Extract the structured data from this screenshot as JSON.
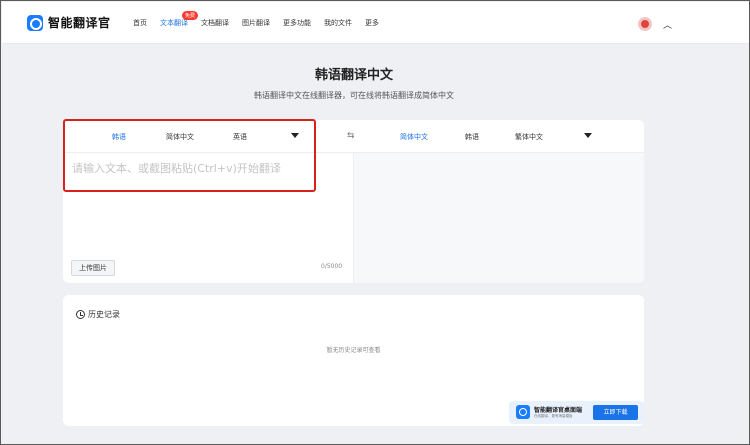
{
  "header": {
    "app_name": "智能翻译官",
    "nav": [
      {
        "label": "首页"
      },
      {
        "label": "文本翻译",
        "badge": "免费"
      },
      {
        "label": "文档翻译"
      },
      {
        "label": "图片翻译"
      },
      {
        "label": "更多功能"
      },
      {
        "label": "我的文件"
      },
      {
        "label": "更多"
      }
    ],
    "icons": {
      "logo": "app-logo",
      "avatar": "user-avatar",
      "collapse": "chevron-up-icon"
    }
  },
  "page": {
    "title": "韩语翻译中文",
    "subtitle": "韩语翻译中文在线翻译器，可在线将韩语翻译成简体中文"
  },
  "translator": {
    "source_langs": [
      "韩语",
      "简体中文",
      "英语"
    ],
    "source_selected": "韩语",
    "target_langs": [
      "简体中文",
      "韩语",
      "繁体中文"
    ],
    "target_selected": "简体中文",
    "placeholder": "请输入文本、或截图粘贴(Ctrl+v)开始翻译",
    "upload_label": "上传图片",
    "char_count": "0/5000",
    "swap_icon": "swap-arrows-icon",
    "accent": "#1a73e8",
    "highlight_color": "#d9211b"
  },
  "history": {
    "title": "历史记录",
    "empty_text": "暂无历史记录可查看"
  },
  "promo": {
    "title": "智能翻译官桌面端",
    "subtitle": "在线翻译，更有海量模板",
    "button": "立即下载"
  }
}
